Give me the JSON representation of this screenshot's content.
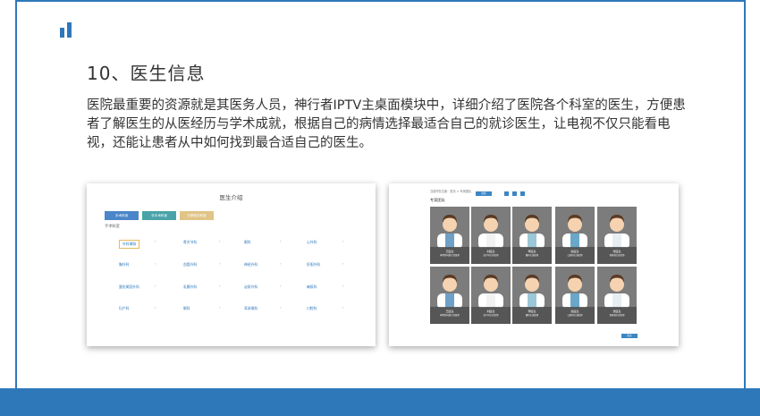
{
  "colors": {
    "brand": "#2e78ba",
    "btn_blue": "#4a86c8",
    "btn_teal": "#4aa3a8",
    "btn_gold": "#e1c487"
  },
  "heading": "10、医生信息",
  "paragraph": "医院最重要的资源就是其医务人员，神行者IPTV主桌面模块中，详细介绍了医院各个科室的医生，方便患者了解医生的从医经历与学术成就，根据自己的病情选择最适合自己的就诊医生，让电视不仅只能看电视，还能让患者从中如何找到最合适自己的医生。",
  "screenshot1": {
    "title": "医生介绍",
    "buttons": [
      "手术科室",
      "非手术科室",
      "方便就诊科室"
    ],
    "subtitle": "手术科室",
    "departments": [
      [
        "外科胃肠",
        "骨关节科",
        "眼科",
        "心外科"
      ],
      [
        "胸外科",
        "血管外科",
        "神经外科",
        "肝胆外科"
      ],
      [
        "整形美容外科",
        "乳腺外科",
        "泌尿外科",
        "麻醉科"
      ],
      [
        "妇产科",
        "眼科",
        "耳鼻喉科",
        "口腔科"
      ]
    ],
    "arrow": "›"
  },
  "screenshot2": {
    "breadcrumb": "当前所在位置：首页 > 专家团队",
    "search_label": "搜索",
    "header": "专家团队",
    "doctors": [
      {
        "name": "王医生",
        "desc": "神经外科副主任医师"
      },
      {
        "name": "刘医生",
        "desc": "妇产科主任医师"
      },
      {
        "name": "李医生",
        "desc": "眼科主治医师"
      },
      {
        "name": "赵医生",
        "desc": "口腔科主治医师"
      },
      {
        "name": "张医生",
        "desc": "骨科副主任医师"
      },
      {
        "name": "王医生",
        "desc": "神经外科副主任医师"
      },
      {
        "name": "刘医生",
        "desc": "妇产科主任医师"
      },
      {
        "name": "李医生",
        "desc": "眼科主治医师"
      },
      {
        "name": "赵医生",
        "desc": "口腔科主治医师"
      },
      {
        "name": "张医生",
        "desc": "骨科副主任医师"
      }
    ],
    "more_label": "更多"
  }
}
